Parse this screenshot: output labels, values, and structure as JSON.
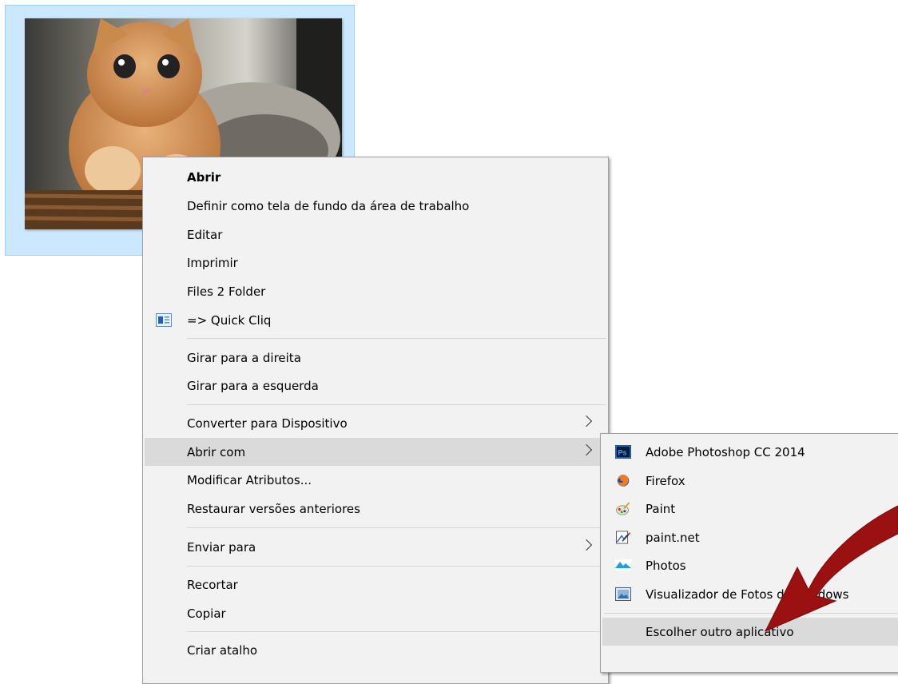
{
  "context_menu": {
    "items": [
      {
        "label": "Abrir"
      },
      {
        "label": "Definir como tela de fundo da área de trabalho"
      },
      {
        "label": "Editar"
      },
      {
        "label": "Imprimir"
      },
      {
        "label": "Files 2 Folder"
      },
      {
        "label": "=> Quick Cliq",
        "icon": "quick-cliq-icon"
      },
      {
        "label": "Girar para a direita"
      },
      {
        "label": "Girar para a esquerda"
      },
      {
        "label": "Converter para Dispositivo",
        "icon": "chevron-right-icon"
      },
      {
        "label": "Abrir com",
        "icon": "chevron-right-icon"
      },
      {
        "label": "Modificar Atributos..."
      },
      {
        "label": "Restaurar versões anteriores"
      },
      {
        "label": "Enviar para",
        "icon": "chevron-right-icon"
      },
      {
        "label": "Recortar"
      },
      {
        "label": "Copiar"
      },
      {
        "label": "Criar atalho"
      }
    ]
  },
  "open_with_submenu": {
    "items": [
      {
        "label": "Adobe Photoshop CC 2014",
        "icon": "photoshop-icon"
      },
      {
        "label": "Firefox",
        "icon": "firefox-icon"
      },
      {
        "label": "Paint",
        "icon": "paint-icon"
      },
      {
        "label": "paint.net",
        "icon": "paintnet-icon"
      },
      {
        "label": "Photos",
        "icon": "photos-icon"
      },
      {
        "label": "Visualizador de Fotos do Windows",
        "icon": "photo-viewer-icon"
      },
      {
        "label": "Escolher outro aplicativo"
      }
    ]
  },
  "colors": {
    "selection_tile": "#cce8ff",
    "menu_background": "#f2f2f2",
    "menu_highlight": "#dadada",
    "annotation_arrow": "#9b1010"
  }
}
